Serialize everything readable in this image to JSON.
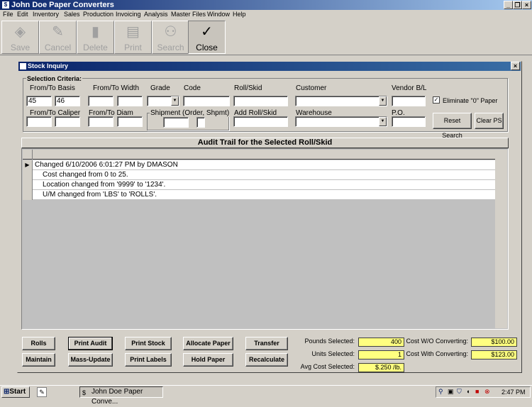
{
  "app": {
    "title": "John Doe Paper Converters",
    "menu": [
      "File",
      "Edit",
      "Inventory",
      "Sales",
      "Production",
      "Invoicing",
      "Analysis",
      "Master Files",
      "Window",
      "Help"
    ],
    "toolbar": [
      {
        "label": "Save",
        "icon": "save-icon"
      },
      {
        "label": "Cancel",
        "icon": "cancel-icon"
      },
      {
        "label": "Delete",
        "icon": "delete-icon"
      },
      {
        "label": "Print",
        "icon": "print-icon"
      },
      {
        "label": "Search",
        "icon": "search-icon"
      },
      {
        "label": "Close",
        "icon": "checkmark-icon"
      }
    ]
  },
  "window": {
    "title": "Stock Inquiry",
    "close_glyph": "×"
  },
  "criteria": {
    "frame_title": "Selection Criteria:",
    "basis_label": "From/To Basis",
    "basis_from": "45",
    "basis_to": "46",
    "width_label": "From/To Width",
    "grade_label": "Grade",
    "code_label": "Code",
    "rollskid_label": "Roll/Skid",
    "customer_label": "Customer",
    "vendor_label": "Vendor B/L",
    "eliminate_label": "Eliminate \"0\" Paper",
    "eliminate_checked": "✓",
    "caliper_label": "From/To Caliper",
    "diam_label": "From/To Diam",
    "shipment_label": "Shipment (Order, Shpmt)",
    "add_rollskid_label": "Add Roll/Skid",
    "warehouse_label": "Warehouse",
    "po_label": "P.O.",
    "reset_label": "Reset Search",
    "clear_label": "Clear PS"
  },
  "grid": {
    "title": "Audit Trail for the Selected Roll/Skid",
    "rows": [
      {
        "text": "Changed 6/10/2006 6:01:27 PM by DMASON",
        "indent": false
      },
      {
        "text": "Cost changed from 0 to 25.",
        "indent": true
      },
      {
        "text": "Location changed from '9999' to '1234'.",
        "indent": true
      },
      {
        "text": "U/M changed from 'LBS' to 'ROLLS'.",
        "indent": true
      }
    ],
    "selected_marker": "▶"
  },
  "buttons": {
    "rolls": "Rolls",
    "print_audit": "Print Audit",
    "print_stock": "Print Stock",
    "allocate": "Allocate Paper",
    "transfer": "Transfer",
    "maintain": "Maintain",
    "mass_update": "Mass-Update",
    "print_labels": "Print Labels",
    "hold_paper": "Hold Paper",
    "recalculate": "Recalculate"
  },
  "summary": {
    "pounds_label": "Pounds Selected:",
    "pounds_value": "400",
    "units_label": "Units Selected:",
    "units_value": "1",
    "avgcost_label": "Avg Cost Selected:",
    "avgcost_value": "$.250 /lb.",
    "cost_wo_label": "Cost W/O Converting:",
    "cost_wo_value": "$100.00",
    "cost_with_label": "Cost With Converting:",
    "cost_with_value": "$123.00"
  },
  "taskbar": {
    "start": "Start",
    "task": "John Doe Paper Conve...",
    "time": "2:47 PM"
  }
}
